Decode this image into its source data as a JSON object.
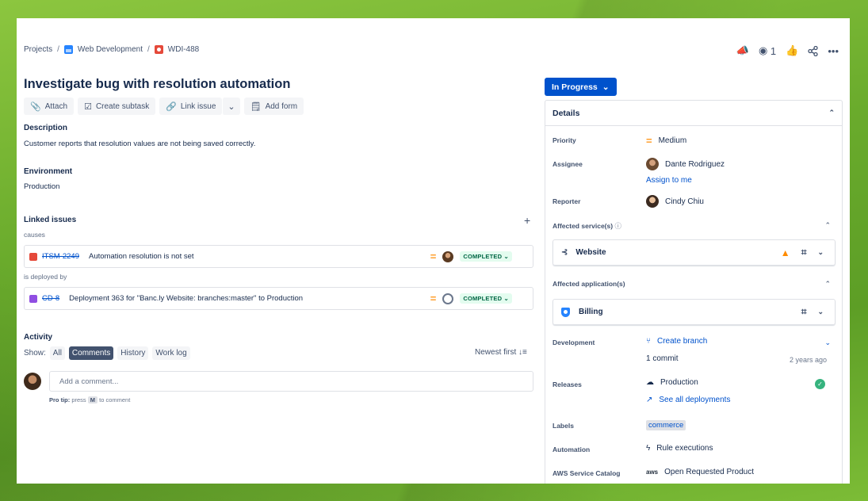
{
  "breadcrumb": {
    "projects": "Projects",
    "sep": "/",
    "project": "Web Development",
    "issue_key": "WDI-488"
  },
  "header_actions": {
    "watch_count": "1"
  },
  "issue": {
    "title": "Investigate bug with resolution automation"
  },
  "toolbar": {
    "attach": "Attach",
    "create_subtask": "Create subtask",
    "link_issue": "Link issue",
    "add_form": "Add form"
  },
  "description": {
    "label": "Description",
    "text": "Customer reports that resolution values are not being saved correctly."
  },
  "environment": {
    "label": "Environment",
    "text": "Production"
  },
  "linked_issues": {
    "label": "Linked issues",
    "groups": [
      {
        "relation": "causes",
        "key": "ITSM-2249",
        "summary": "Automation resolution is not set",
        "status": "COMPLETED"
      },
      {
        "relation": "is deployed by",
        "key": "CD-8",
        "summary": "Deployment 363 for \"Banc.ly Website: branches:master\" to Production",
        "status": "COMPLETED"
      }
    ]
  },
  "activity": {
    "label": "Activity",
    "show_label": "Show:",
    "filters": [
      "All",
      "Comments",
      "History",
      "Work log"
    ],
    "sort": "Newest first",
    "comment_placeholder": "Add a comment...",
    "pro_tip_label": "Pro tip:",
    "pro_tip_press": "press",
    "pro_tip_key": "M",
    "pro_tip_rest": "to comment"
  },
  "status_button": "In Progress",
  "details": {
    "header": "Details",
    "priority_label": "Priority",
    "priority_value": "Medium",
    "assignee_label": "Assignee",
    "assignee_value": "Dante Rodriguez",
    "assign_to_me": "Assign to me",
    "reporter_label": "Reporter",
    "reporter_value": "Cindy Chiu",
    "affected_services_label": "Affected service(s)",
    "service_name": "Website",
    "affected_apps_label": "Affected application(s)",
    "app_name": "Billing",
    "development_label": "Development",
    "create_branch": "Create branch",
    "commits": "1 commit",
    "commit_time": "2 years ago",
    "releases_label": "Releases",
    "release_env": "Production",
    "see_deployments": "See all deployments",
    "labels_label": "Labels",
    "label_tag": "commerce",
    "automation_label": "Automation",
    "rule_executions": "Rule executions",
    "aws_label": "AWS Service Catalog",
    "aws_badge": "aws",
    "aws_action": "Open Requested Product"
  },
  "colors": {
    "accent": "#0052cc",
    "background_green": "#74b32f",
    "completed_bg": "#e3fcef",
    "completed_text": "#006644",
    "priority_medium": "#ff991f"
  }
}
